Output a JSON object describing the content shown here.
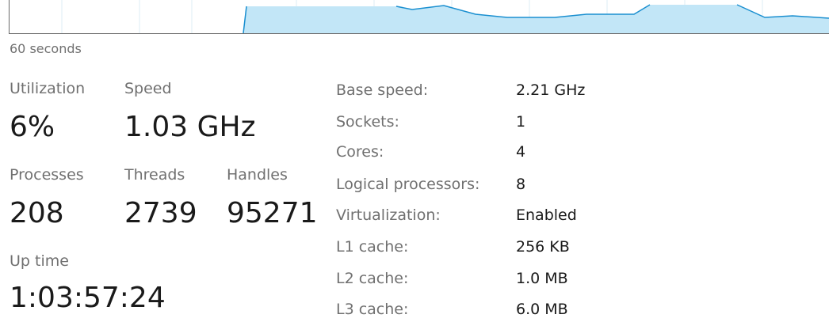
{
  "graph": {
    "time_span_label": "60 seconds",
    "fill_color": "#c2e6f7",
    "line_color": "#1a8fd0",
    "grid_color": "#dcecf5",
    "border_color": "#6a6a6a"
  },
  "stats": {
    "utilization": {
      "label": "Utilization",
      "value": "6%"
    },
    "speed": {
      "label": "Speed",
      "value": "1.03 GHz"
    },
    "processes": {
      "label": "Processes",
      "value": "208"
    },
    "threads": {
      "label": "Threads",
      "value": "2739"
    },
    "handles": {
      "label": "Handles",
      "value": "95271"
    },
    "uptime": {
      "label": "Up time",
      "value": "1:03:57:24"
    }
  },
  "details": [
    {
      "label": "Base speed:",
      "value": "2.21 GHz"
    },
    {
      "label": "Sockets:",
      "value": "1"
    },
    {
      "label": "Cores:",
      "value": "4"
    },
    {
      "label": "Logical processors:",
      "value": "8"
    },
    {
      "label": "Virtualization:",
      "value": "Enabled"
    },
    {
      "label": "L1 cache:",
      "value": "256 KB"
    },
    {
      "label": "L2 cache:",
      "value": "1.0 MB"
    },
    {
      "label": "L3 cache:",
      "value": "6.0 MB"
    }
  ]
}
